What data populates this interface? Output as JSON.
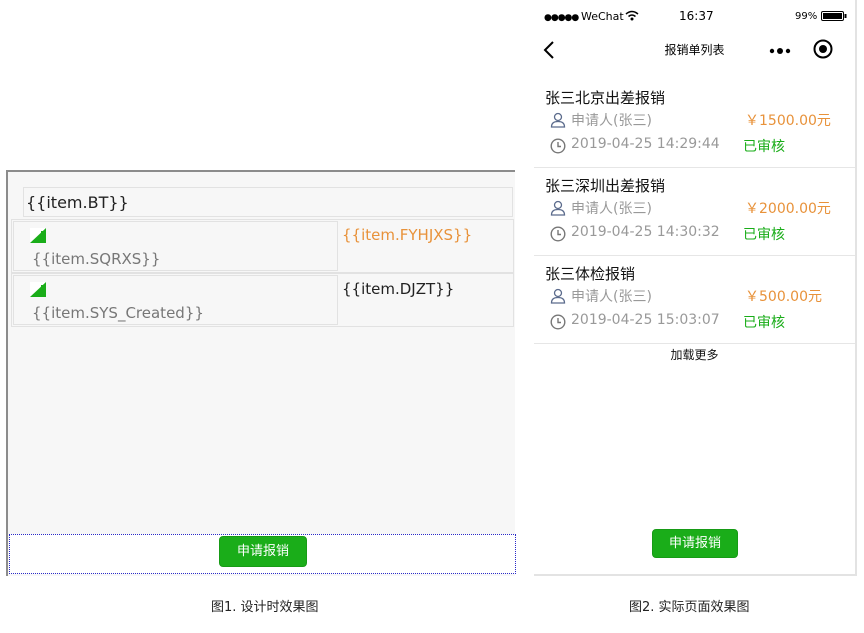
{
  "design": {
    "title_tpl": "{{item.BT}}",
    "rows": [
      {
        "sub_tpl": "{{item.SQRXS}}",
        "right_tpl": "{{item.FYHJXS}}"
      },
      {
        "sub_tpl": "{{item.SYS_Created}}",
        "right_tpl": "{{item.DJZT}}"
      }
    ],
    "button_label": "申请报销"
  },
  "phone": {
    "status": {
      "signal": "●●●●●",
      "carrier": "WeChat",
      "time": "16:37",
      "battery": "99%"
    },
    "nav_title": "报销单列表",
    "items": [
      {
        "title": "张三北京出差报销",
        "applicant": "申请人(张三)",
        "amount": "￥1500.00元",
        "date": "2019-04-25 14:29:44",
        "status": "已审核"
      },
      {
        "title": "张三深圳出差报销",
        "applicant": "申请人(张三)",
        "amount": "￥2000.00元",
        "date": "2019-04-25 14:30:32",
        "status": "已审核"
      },
      {
        "title": "张三体检报销",
        "applicant": "申请人(张三)",
        "amount": "￥500.00元",
        "date": "2019-04-25 15:03:07",
        "status": "已审核"
      }
    ],
    "load_more": "加载更多",
    "button_label": "申请报销"
  },
  "captions": {
    "fig1": "图1. 设计时效果图",
    "fig2": "图2. 实际页面效果图"
  },
  "colors": {
    "accent_green": "#1aad19",
    "amount_orange": "#e8923a"
  },
  "icons": [
    "image-placeholder-icon",
    "user-icon",
    "clock-icon",
    "back-icon",
    "more-icon",
    "target-icon",
    "wifi-icon",
    "battery-icon"
  ]
}
